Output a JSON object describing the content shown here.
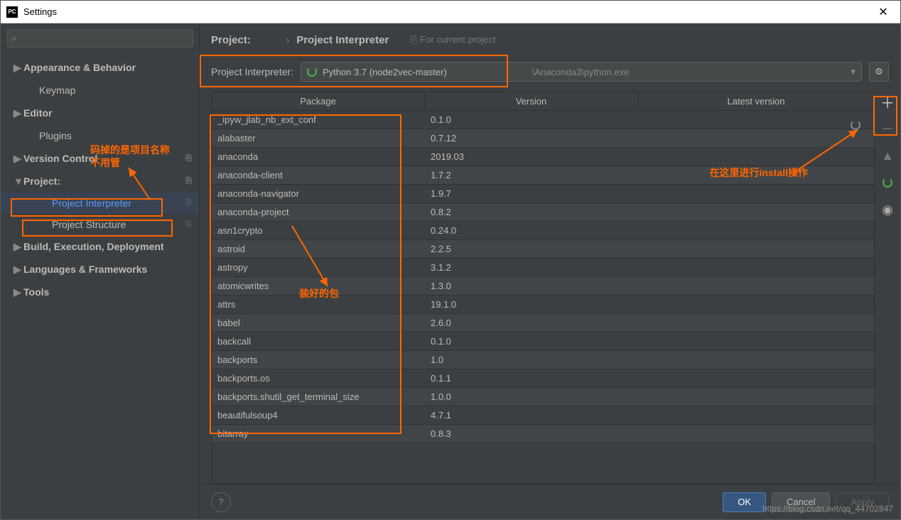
{
  "window": {
    "title": "Settings"
  },
  "breadcrumb": {
    "project_label": "Project:",
    "page": "Project Interpreter",
    "hint": "For current project",
    "hint_icon": "⎘"
  },
  "sidebar": {
    "items": [
      {
        "label": "Appearance & Behavior",
        "expandable": true,
        "bold": true
      },
      {
        "label": "Keymap",
        "expandable": false,
        "bold": true,
        "child": true
      },
      {
        "label": "Editor",
        "expandable": true,
        "bold": true
      },
      {
        "label": "Plugins",
        "expandable": false,
        "bold": true,
        "child": true
      },
      {
        "label": "Version Control",
        "expandable": true,
        "bold": true,
        "copy": true
      },
      {
        "label": "Project:",
        "expandable": true,
        "bold": true,
        "expanded": true,
        "copy": true
      },
      {
        "label": "Project Interpreter",
        "child2": true,
        "selected": true,
        "copy": true
      },
      {
        "label": "Project Structure",
        "child2": true,
        "copy": true
      },
      {
        "label": "Build, Execution, Deployment",
        "expandable": true,
        "bold": true
      },
      {
        "label": "Languages & Frameworks",
        "expandable": true,
        "bold": true
      },
      {
        "label": "Tools",
        "expandable": true,
        "bold": true
      }
    ]
  },
  "interpreter": {
    "label": "Project Interpreter:",
    "value": "Python 3.7 (node2vec-master)",
    "path_suffix": "\\Anaconda3\\python.exe"
  },
  "table": {
    "headers": {
      "package": "Package",
      "version": "Version",
      "latest": "Latest version"
    },
    "rows": [
      {
        "pkg": "_ipyw_jlab_nb_ext_conf",
        "ver": "0.1.0"
      },
      {
        "pkg": "alabaster",
        "ver": "0.7.12"
      },
      {
        "pkg": "anaconda",
        "ver": "2019.03"
      },
      {
        "pkg": "anaconda-client",
        "ver": "1.7.2"
      },
      {
        "pkg": "anaconda-navigator",
        "ver": "1.9.7"
      },
      {
        "pkg": "anaconda-project",
        "ver": "0.8.2"
      },
      {
        "pkg": "asn1crypto",
        "ver": "0.24.0"
      },
      {
        "pkg": "astroid",
        "ver": "2.2.5"
      },
      {
        "pkg": "astropy",
        "ver": "3.1.2"
      },
      {
        "pkg": "atomicwrites",
        "ver": "1.3.0"
      },
      {
        "pkg": "attrs",
        "ver": "19.1.0"
      },
      {
        "pkg": "babel",
        "ver": "2.6.0"
      },
      {
        "pkg": "backcall",
        "ver": "0.1.0"
      },
      {
        "pkg": "backports",
        "ver": "1.0"
      },
      {
        "pkg": "backports.os",
        "ver": "0.1.1"
      },
      {
        "pkg": "backports.shutil_get_terminal_size",
        "ver": "1.0.0"
      },
      {
        "pkg": "beautifulsoup4",
        "ver": "4.7.1"
      },
      {
        "pkg": "bitarray",
        "ver": "0.8.3"
      }
    ]
  },
  "annotations": {
    "a1_line1": "码掉的是项目名称",
    "a1_line2": "不用管",
    "a2": "装好的包",
    "a3": "在这里进行install操作"
  },
  "footer": {
    "ok": "OK",
    "cancel": "Cancel",
    "apply": "Apply"
  },
  "watermark": "https://blog.csdn.net/qq_44702847"
}
